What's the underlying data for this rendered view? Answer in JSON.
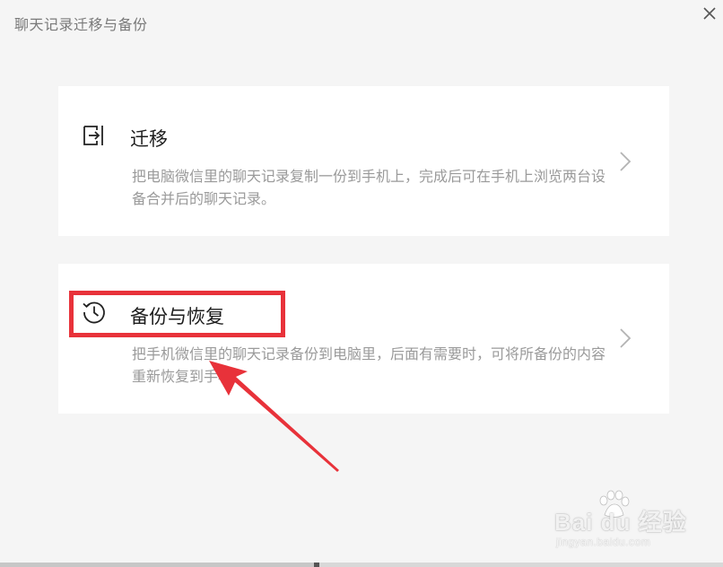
{
  "window": {
    "title": "聊天记录迁移与备份"
  },
  "cards": [
    {
      "title": "迁移",
      "description": "把电脑微信里的聊天记录复制一份到手机上，完成后可在手机上浏览两台设备合并后的聊天记录。",
      "icon": "import-icon"
    },
    {
      "title": "备份与恢复",
      "description": "把手机微信里的聊天记录备份到电脑里，后面有需要时，可将所备份的内容重新恢复到手机。",
      "icon": "history-clock-icon"
    }
  ],
  "watermark": {
    "brand": "Bai du 经验",
    "url": "jingyan.baidu.com"
  },
  "colors": {
    "background": "#f5f5f5",
    "card": "#ffffff",
    "title_text": "#1c1c1c",
    "desc_text": "#9a9a9a",
    "annotation": "#e8323a"
  }
}
